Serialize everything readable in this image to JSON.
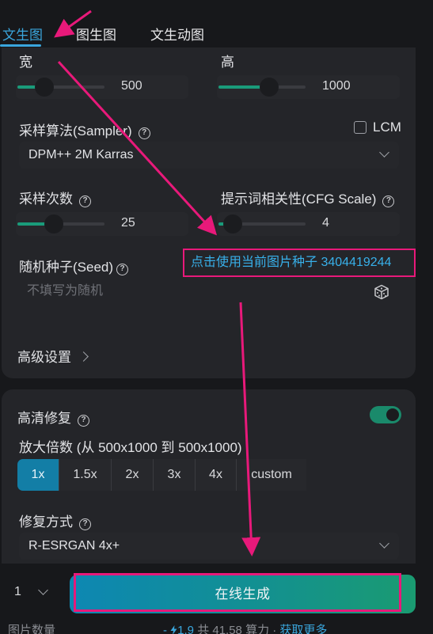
{
  "tabs": [
    {
      "label": "文生图",
      "active": true
    },
    {
      "label": "图生图",
      "active": false
    },
    {
      "label": "文生动图",
      "active": false
    }
  ],
  "size": {
    "width_label": "宽",
    "width_value": "500",
    "height_label": "高",
    "height_value": "1000"
  },
  "sampler": {
    "label": "采样算法(Sampler)",
    "lcm_label": "LCM",
    "lcm_checked": false,
    "selected": "DPM++ 2M Karras"
  },
  "steps": {
    "label": "采样次数",
    "value": "25"
  },
  "cfg": {
    "label": "提示词相关性(CFG Scale)",
    "value": "4"
  },
  "seed": {
    "label": "随机种子(Seed)",
    "use_current_link": "点击使用当前图片种子 3404419244",
    "placeholder": "不填写为随机"
  },
  "advanced": {
    "label": "高级设置"
  },
  "hires": {
    "label": "高清修复",
    "enabled": true,
    "scale_label": "放大倍数 (从 500x1000 到 500x1000)",
    "scale_options": [
      "1x",
      "1.5x",
      "2x",
      "3x",
      "4x",
      "custom"
    ],
    "scale_selected": "1x",
    "method_label": "修复方式",
    "method_selected": "R-ESRGAN 4x+"
  },
  "footer": {
    "image_count": "1",
    "image_count_label": "图片数量",
    "generate_button": "在线生成",
    "cost_prefix": "- ",
    "cost_value": "1.9",
    "cost_total": " 共 41.58 算力 · ",
    "get_more": "获取更多"
  },
  "colors": {
    "accent": "#3aa6dd",
    "toggle_on": "#1a8a6b",
    "annotation": "#e8197a"
  },
  "icons": [
    "help-icon",
    "chevron-down-icon",
    "chevron-right-icon",
    "dice-icon",
    "lightning-icon"
  ]
}
